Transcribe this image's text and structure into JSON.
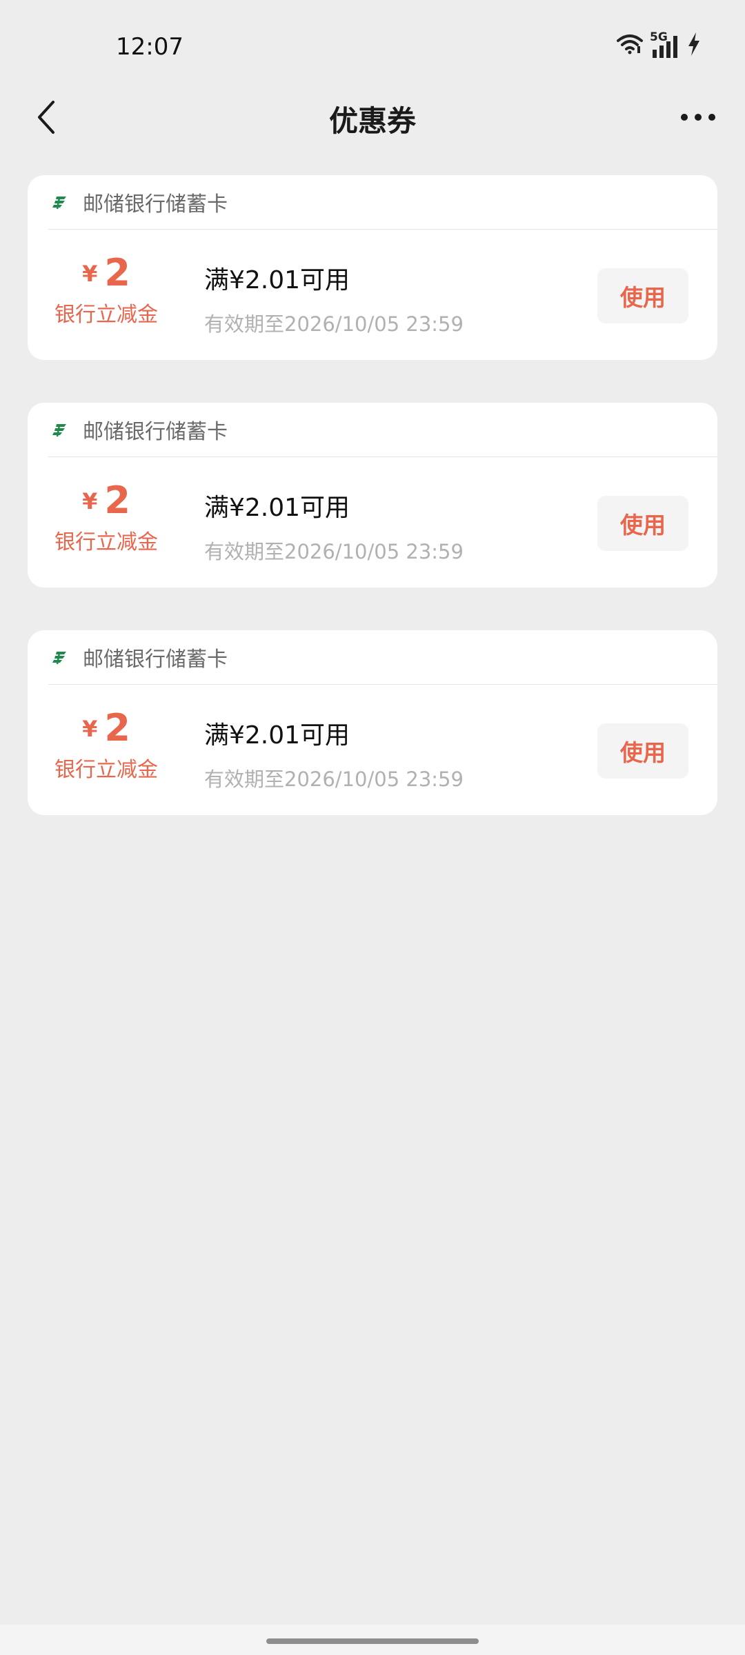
{
  "status_bar": {
    "time": "12:07",
    "network": "5G"
  },
  "nav": {
    "title": "优惠券"
  },
  "colors": {
    "accent": "#e8664c",
    "bank_green": "#1e8a4c",
    "background": "#ededed"
  },
  "coupons": [
    {
      "bank_name": "邮储银行储蓄卡",
      "currency": "¥",
      "amount": "2",
      "type": "银行立减金",
      "condition": "满¥2.01可用",
      "expiry": "有效期至2026/10/05 23:59",
      "button_label": "使用"
    },
    {
      "bank_name": "邮储银行储蓄卡",
      "currency": "¥",
      "amount": "2",
      "type": "银行立减金",
      "condition": "满¥2.01可用",
      "expiry": "有效期至2026/10/05 23:59",
      "button_label": "使用"
    },
    {
      "bank_name": "邮储银行储蓄卡",
      "currency": "¥",
      "amount": "2",
      "type": "银行立减金",
      "condition": "满¥2.01可用",
      "expiry": "有效期至2026/10/05 23:59",
      "button_label": "使用"
    }
  ]
}
